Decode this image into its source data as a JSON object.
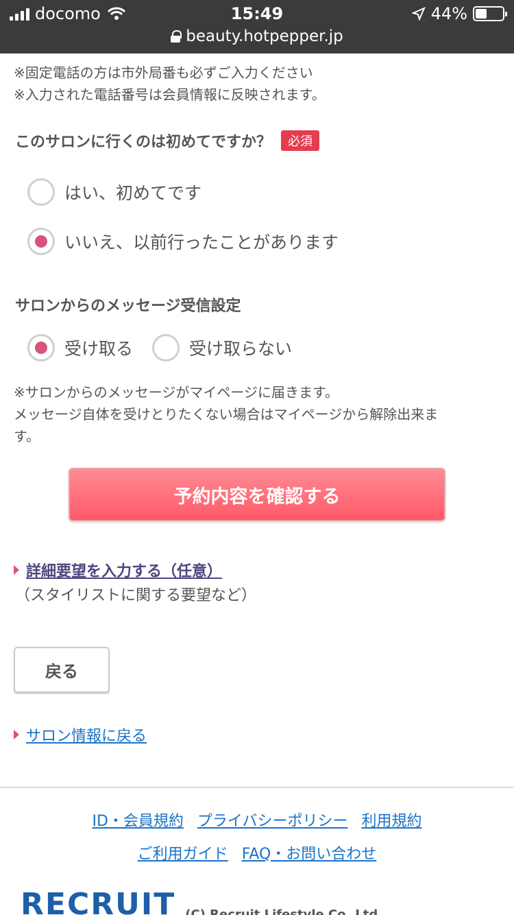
{
  "status_bar": {
    "carrier": "docomo",
    "time": "15:49",
    "battery": "44%",
    "url": "beauty.hotpepper.jp"
  },
  "phone_notes": [
    "※固定電話の方は市外局番も必ずご入力ください",
    "※入力された電話番号は会員情報に反映されます。"
  ],
  "first_visit": {
    "question": "このサロンに行くのは初めてですか？",
    "required_badge": "必須",
    "options": [
      {
        "label": "はい、初めてです",
        "checked": false
      },
      {
        "label": "いいえ、以前行ったことがあります",
        "checked": true
      }
    ]
  },
  "message_setting": {
    "question": "サロンからのメッセージ受信設定",
    "options": [
      {
        "label": "受け取る",
        "checked": true
      },
      {
        "label": "受け取らない",
        "checked": false
      }
    ],
    "notes": [
      "※サロンからのメッセージがマイページに届きます。",
      "メッセージ自体を受けとりたくない場合はマイページから解除出来ま",
      "す。"
    ]
  },
  "confirm_button": "予約内容を確認する",
  "detail_request": {
    "link": "詳細要望を入力する（任意）",
    "note": "（スタイリストに関する要望など）"
  },
  "back_button": "戻る",
  "salon_link": "サロン情報に戻る",
  "footer": {
    "row1": [
      "ID・会員規約",
      "プライバシーポリシー",
      "利用規約"
    ],
    "row2": [
      "ご利用ガイド",
      "FAQ・お問い合わせ"
    ],
    "logo": "RECRUIT",
    "copyright": "(C) Recruit Lifestyle Co.,Ltd."
  },
  "colors": {
    "accent_pink": "#d9547a",
    "required_red": "#e43d4f",
    "confirm_button": "#ff5a68",
    "link_blue": "#1a73c8"
  }
}
